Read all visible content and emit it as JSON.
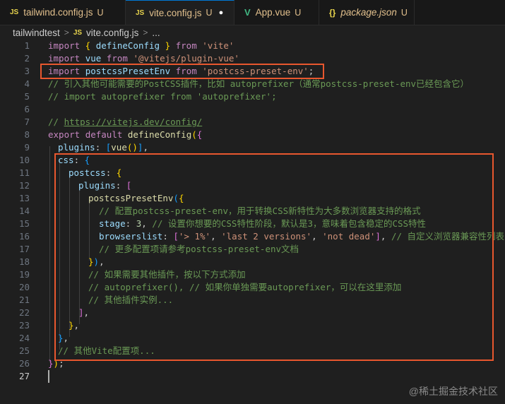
{
  "tabs": [
    {
      "icon": "JS",
      "label": "tailwind.config.js",
      "status": "U"
    },
    {
      "icon": "JS",
      "label": "vite.config.js",
      "status": "U"
    },
    {
      "icon": "V",
      "label": "App.vue",
      "status": "U"
    },
    {
      "icon": "{}",
      "label": "package.json",
      "status": "U"
    }
  ],
  "breadcrumb": {
    "folder": "tailwindtest",
    "icon": "JS",
    "file": "vite.config.js",
    "more": "..."
  },
  "line_numbers": [
    "1",
    "2",
    "3",
    "4",
    "5",
    "6",
    "7",
    "8",
    "9",
    "10",
    "11",
    "12",
    "13",
    "14",
    "15",
    "16",
    "17",
    "18",
    "19",
    "20",
    "21",
    "22",
    "23",
    "24",
    "25",
    "26",
    "27"
  ],
  "code": {
    "l1": [
      "import",
      " { ",
      "defineConfig",
      " } ",
      "from",
      " ",
      "'vite'"
    ],
    "l2": [
      "import",
      " ",
      "vue",
      " ",
      "from",
      " ",
      "'@vitejs/plugin-vue'"
    ],
    "l3": [
      "import",
      " ",
      "postcssPresetEnv",
      " ",
      "from",
      " ",
      "'postcss-preset-env'",
      ";"
    ],
    "l4": "// 引入其他可能需要的PostCSS插件，比如 autoprefixer（通常postcss-preset-env已经包含它）",
    "l5": "// import autoprefixer from 'autoprefixer';",
    "l7a": "// ",
    "l7b": "https://vitejs.dev/config/",
    "l8": [
      "export",
      " ",
      "default",
      " ",
      "defineConfig",
      "(",
      "{"
    ],
    "l9": [
      "plugins",
      ": ",
      "[",
      "vue",
      "()",
      "]",
      ","
    ],
    "l10": [
      "css",
      ": ",
      "{"
    ],
    "l11": [
      "postcss",
      ": ",
      "{"
    ],
    "l12": [
      "plugins",
      ": ",
      "["
    ],
    "l13": [
      "postcssPresetEnv",
      "(",
      "{"
    ],
    "l14": "// 配置postcss-preset-env，用于转换CSS新特性为大多数浏览器支持的格式",
    "l15": [
      "stage",
      ": ",
      "3",
      ", ",
      "// 设置你想要的CSS特性阶段，默认是3，意味着包含稳定的CSS特性"
    ],
    "l16": [
      "browserslist",
      ": ",
      "[",
      "'> 1%'",
      ", ",
      "'last 2 versions'",
      ", ",
      "'not dead'",
      "]",
      ", ",
      "// 自定义浏览器兼容性列表"
    ],
    "l17": "// 更多配置项请参考postcss-preset-env文档",
    "l18": [
      "}",
      ")",
      ","
    ],
    "l19": "// 如果需要其他插件，按以下方式添加",
    "l20": "// autoprefixer(), // 如果你单独需要autoprefixer，可以在这里添加",
    "l21": "// 其他插件实例...",
    "l22": [
      "]",
      ","
    ],
    "l23": [
      "}",
      ","
    ],
    "l24": [
      "}",
      ","
    ],
    "l25": "// 其他Vite配置项...",
    "l26": [
      "}",
      ")",
      ";"
    ]
  },
  "watermark": "@稀土掘金技术社区",
  "colors": {
    "annotation": "#e8572e",
    "keyword": "#c586c0",
    "string": "#ce9178",
    "comment": "#6a9955",
    "variable": "#9cdcfe"
  }
}
